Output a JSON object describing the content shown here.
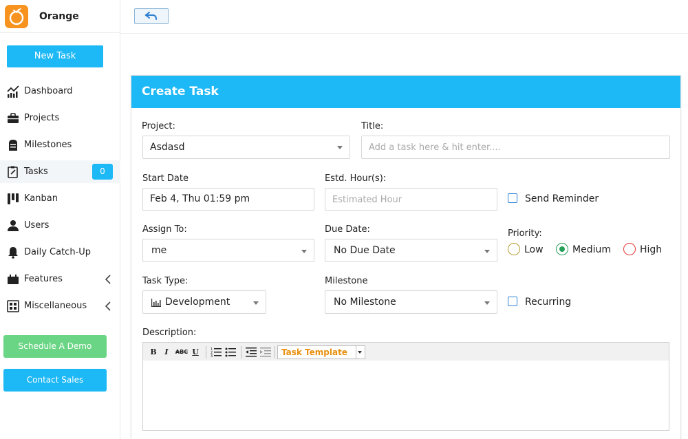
{
  "brand": {
    "name": "Orange"
  },
  "sidebar": {
    "new_task_label": "New Task",
    "items": [
      {
        "label": "Dashboard",
        "icon": "chart-icon"
      },
      {
        "label": "Projects",
        "icon": "briefcase-icon"
      },
      {
        "label": "Milestones",
        "icon": "milestone-icon"
      },
      {
        "label": "Tasks",
        "icon": "task-icon",
        "badge": "0",
        "active": true
      },
      {
        "label": "Kanban",
        "icon": "kanban-icon"
      },
      {
        "label": "Users",
        "icon": "user-icon"
      },
      {
        "label": "Daily Catch-Up",
        "icon": "bell-icon"
      },
      {
        "label": "Features",
        "icon": "features-icon",
        "expandable": true
      },
      {
        "label": "Miscellaneous",
        "icon": "grid-icon",
        "expandable": true
      }
    ],
    "schedule_demo_label": "Schedule A Demo",
    "contact_sales_label": "Contact Sales"
  },
  "topbar": {
    "back_icon": "undo-icon"
  },
  "form": {
    "title": "Create Task",
    "project": {
      "label": "Project:",
      "value": "Asdasd"
    },
    "task_title": {
      "label": "Title:",
      "placeholder": "Add a task here & hit enter...."
    },
    "start_date": {
      "label": "Start Date",
      "value": "Feb 4, Thu 01:59 pm"
    },
    "estd_hours": {
      "label": "Estd. Hour(s):",
      "placeholder": "Estimated Hour"
    },
    "send_reminder": {
      "label": "Send Reminder",
      "checked": false
    },
    "assign_to": {
      "label": "Assign To:",
      "value": "me"
    },
    "due_date": {
      "label": "Due Date:",
      "value": "No Due Date"
    },
    "priority": {
      "label": "Priority:",
      "options": [
        "Low",
        "Medium",
        "High"
      ],
      "selected": "Medium",
      "colors": {
        "Low": "#b59a2e",
        "Medium": "#27a05a",
        "High": "#e53935"
      }
    },
    "task_type": {
      "label": "Task Type:",
      "value": "Development"
    },
    "milestone": {
      "label": "Milestone",
      "value": "No Milestone"
    },
    "recurring": {
      "label": "Recurring",
      "checked": false
    },
    "description": {
      "label": "Description:",
      "template_label": "Task Template",
      "toolbar": {
        "bold": "B",
        "italic": "I",
        "strike": "ABC",
        "underline": "U"
      }
    }
  },
  "colors": {
    "accent": "#1db8f6",
    "demo": "#6ad584",
    "brand": "#f7931e"
  }
}
